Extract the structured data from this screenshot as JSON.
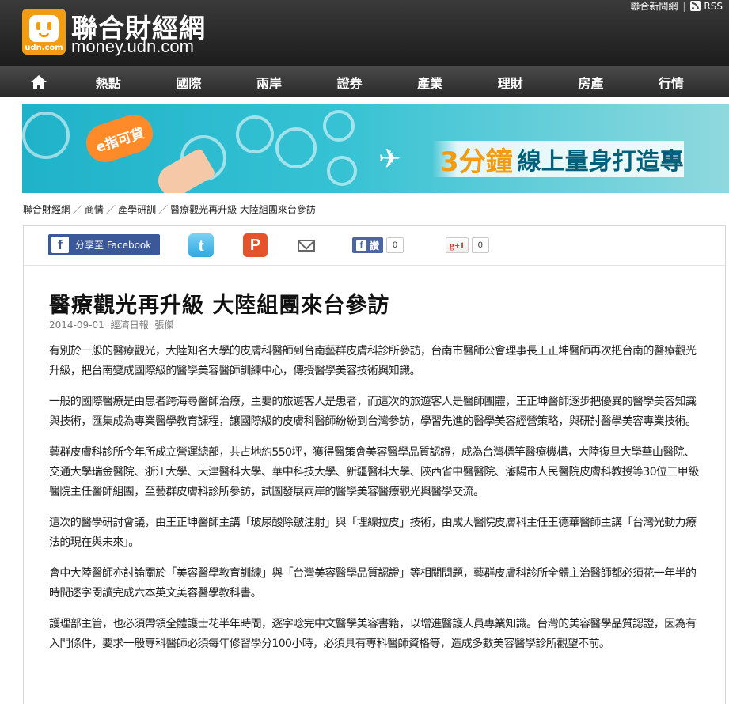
{
  "header": {
    "logo_text": "udn.com",
    "site_name": "聯合財經網",
    "site_domain": "money.udn.com",
    "top_links": [
      "聯合新聞網",
      "RSS"
    ]
  },
  "nav": {
    "home_icon": "home-icon",
    "items": [
      "熱點",
      "國際",
      "兩岸",
      "證券",
      "產業",
      "理財",
      "房產",
      "行情"
    ]
  },
  "banner": {
    "tag": "e指可貸",
    "minutes": "3分鐘",
    "subtitle": "線上量身打造專"
  },
  "breadcrumb": [
    "聯合財經網",
    "商情",
    "產學研訓",
    "醫療觀光再升級 大陸組團來台參訪"
  ],
  "share": {
    "facebook_label": "分享至 Facebook",
    "twitter_icon": "twitter-icon",
    "plurk_icon": "plurk-icon",
    "mail_icon": "mail-icon",
    "like_label": "讚",
    "like_count": "0",
    "gplus_label": "g+1",
    "gplus_count": "0"
  },
  "article": {
    "title": "醫療觀光再升級 大陸組團來台參訪",
    "date": "2014-09-01",
    "source": "經濟日報",
    "author": "張傑",
    "paragraphs": [
      "有別於一般的醫療觀光，大陸知名大學的皮膚科醫師到台南藝群皮膚科診所參訪，台南市醫師公會理事長王正坤醫師再次把台南的醫療觀光升級，把台南變成國際級的醫學美容醫師訓練中心，傳授醫學美容技術與知識。",
      "一般的國際醫療是由患者跨海尋醫師治療，主要的旅遊客人是患者，而這次的旅遊客人是醫師團體，王正坤醫師逐步把優異的醫學美容知識與技術，匯集成為專業醫學教育課程，讓國際級的皮膚科醫師紛紛到台灣參訪，學習先進的醫學美容經營策略，與研討醫學美容專業技術。",
      "藝群皮膚科診所今年所成立營運總部，共占地約550坪，獲得醫策會美容醫學品質認證，成為台灣標竿醫療機構，大陸復旦大學華山醫院、交通大學瑞金醫院、浙江大學、天津醫科大學、華中科技大學、新疆醫科大學、陝西省中醫醫院、瀋陽市人民醫院皮膚科教授等30位三甲級醫院主任醫師組團，至藝群皮膚科診所參訪，試圖發展兩岸的醫學美容醫療觀光與醫學交流。",
      "這次的醫學研討會議，由王正坤醫師主講「玻尿酸除皺注射」與「埋線拉皮」技術，由成大醫院皮膚科主任王德華醫師主講「台灣光動力療法的現在與未來」。",
      "會中大陸醫師亦討論關於「美容醫學教育訓練」與「台灣美容醫學品質認證」等相關問題，藝群皮膚科診所全體主治醫師都必須花一年半的時間逐字閱讀完成六本英文美容醫學教科書。",
      "護理部主管，也必須帶領全體護士花半年時間，逐字唸完中文醫學美容書籍，以增進醫護人員專業知識。台灣的美容醫學品質認證，因為有入門條件，要求一般專科醫師必須每年修習學分100小時，必須具有專科醫師資格等，造成多數美容醫學診所觀望不前。"
    ]
  }
}
